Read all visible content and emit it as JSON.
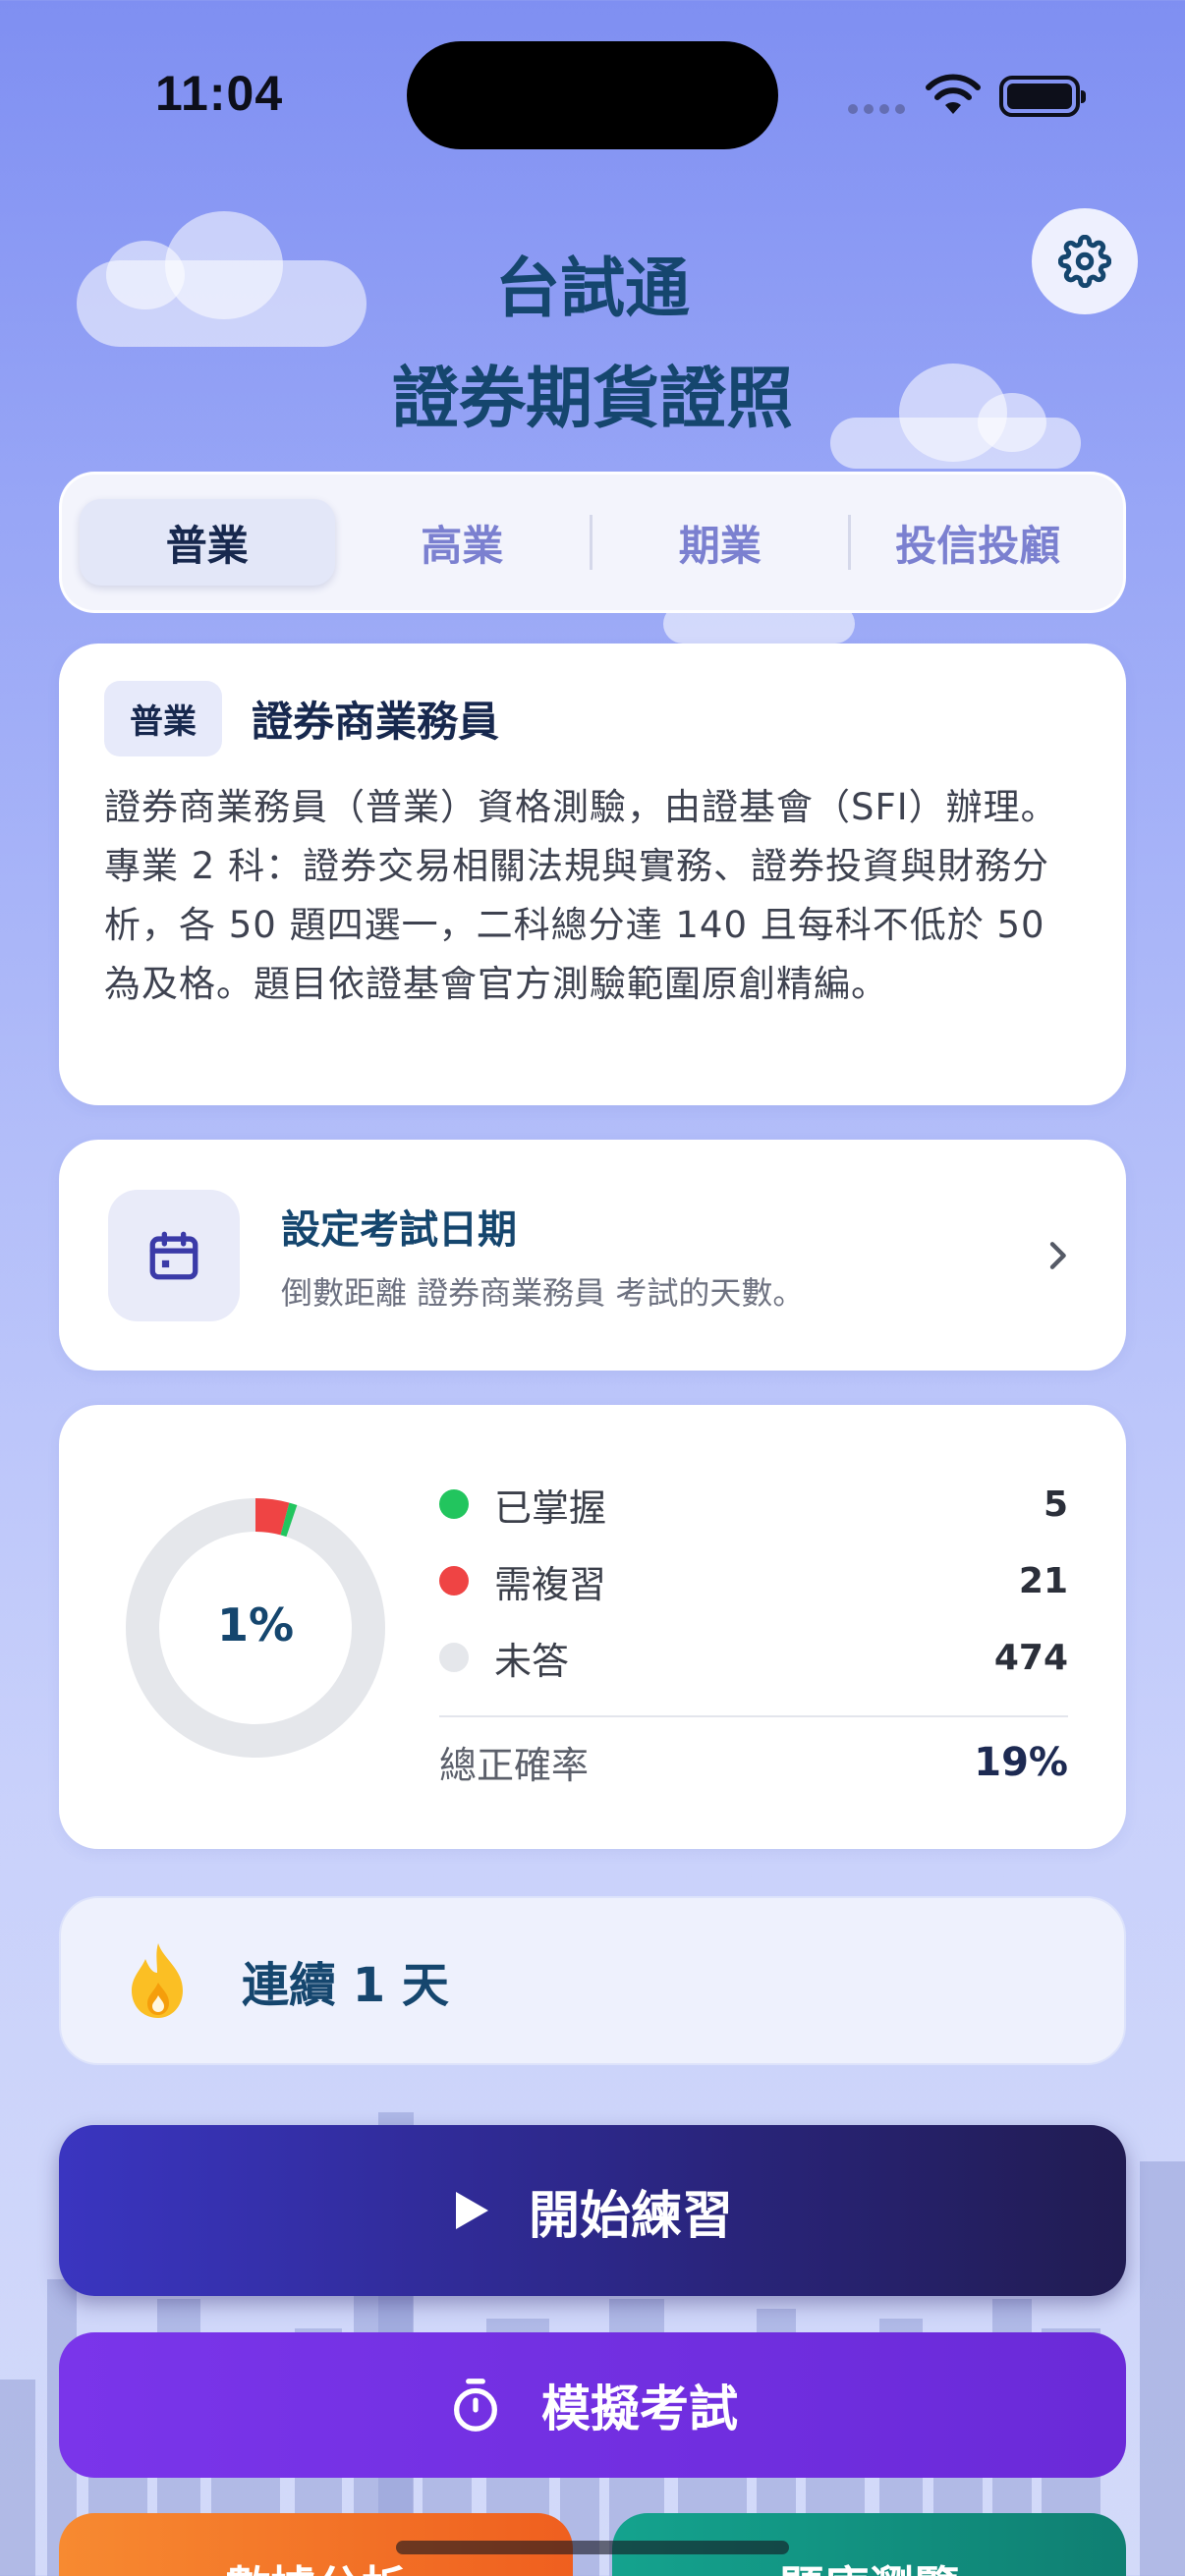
{
  "status_bar": {
    "time": "11:04"
  },
  "header": {
    "title_line1": "台試通",
    "title_line2": "證券期貨證照"
  },
  "tabs": [
    {
      "label": "普業",
      "active": true
    },
    {
      "label": "高業",
      "active": false
    },
    {
      "label": "期業",
      "active": false
    },
    {
      "label": "投信投顧",
      "active": false
    }
  ],
  "info": {
    "badge": "普業",
    "name": "證券商業務員",
    "description": "證券商業務員（普業）資格測驗，由證基會（SFI）辦理。專業 2 科：證券交易相關法規與實務、證券投資與財務分析，各 50 題四選一，二科總分達 140 且每科不低於 50 為及格。題目依證基會官方測驗範圍原創精編。"
  },
  "exam_date": {
    "title": "設定考試日期",
    "subtitle": "倒數距離 證券商業務員 考試的天數。",
    "icon": "calendar-icon"
  },
  "stats": {
    "progress_label": "1%",
    "mastered_fraction": 0.01,
    "review_fraction": 0.042,
    "legend": [
      {
        "label": "已掌握",
        "value": "5",
        "color": "#22c55e"
      },
      {
        "label": "需複習",
        "value": "21",
        "color": "#ef4444"
      },
      {
        "label": "未答",
        "value": "474",
        "color": "#e5e7eb"
      }
    ],
    "accuracy_label": "總正確率",
    "accuracy_value": "19%"
  },
  "streak": {
    "text": "連續 1 天",
    "icon": "flame-icon"
  },
  "buttons": {
    "start": "開始練習",
    "mock": "模擬考試",
    "analysis": "數據分析",
    "bank": "題庫瀏覽"
  },
  "colors": {
    "accent": "#15466e",
    "start_button": "#2a257e",
    "mock_button": "#7030e0",
    "analysis_button": "#f47a2a",
    "bank_button": "#14a38e"
  }
}
